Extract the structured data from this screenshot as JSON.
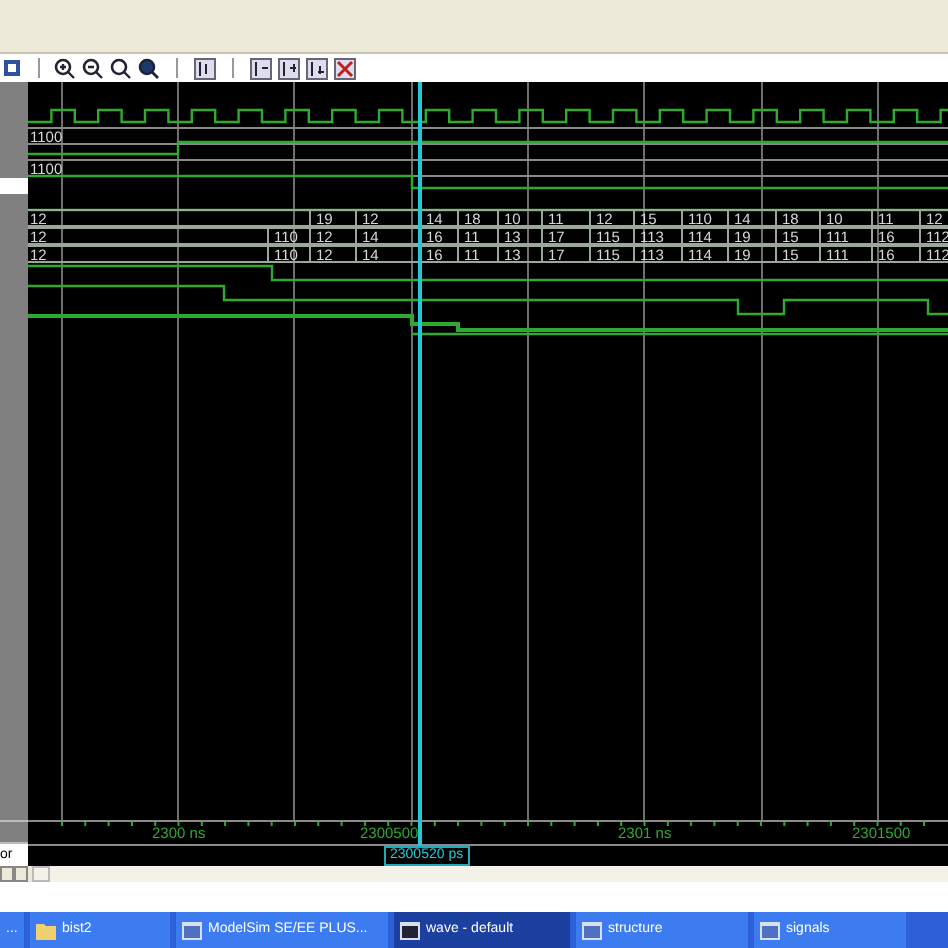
{
  "wave_rows": [
    {
      "kind": "clock"
    },
    {
      "kind": "bus",
      "values": [
        "1100"
      ]
    },
    {
      "kind": "bit"
    },
    {
      "kind": "bus",
      "values": [
        "1100"
      ]
    },
    {
      "kind": "bit"
    },
    {
      "kind": "bit"
    },
    {
      "kind": "bus",
      "values": [
        "12",
        "19",
        "12",
        "14",
        "18",
        "10",
        "11",
        "12",
        "15",
        "110",
        "14",
        "18",
        "10",
        "11",
        "12"
      ]
    },
    {
      "kind": "bus",
      "values": [
        "12",
        "110",
        "12",
        "14",
        "16",
        "11",
        "13",
        "17",
        "115",
        "113",
        "114",
        "19",
        "15",
        "111",
        "16",
        "112"
      ]
    },
    {
      "kind": "bus",
      "values": [
        "12",
        "110",
        "12",
        "14",
        "16",
        "11",
        "13",
        "17",
        "115",
        "113",
        "114",
        "19",
        "15",
        "111",
        "16",
        "112"
      ]
    },
    {
      "kind": "bit"
    },
    {
      "kind": "bit"
    },
    {
      "kind": "bit"
    },
    {
      "kind": "bit"
    }
  ],
  "ruler": {
    "labels": [
      "2300 ns",
      "2300500",
      "2301 ns",
      "2301500"
    ]
  },
  "cursor": {
    "time": "2300520 ps"
  },
  "left_pane": {
    "cursor_label": "or"
  },
  "taskbar": {
    "items": [
      {
        "label": "...",
        "selected": false
      },
      {
        "label": "bist2",
        "selected": false
      },
      {
        "label": "ModelSim SE/EE PLUS...",
        "selected": false
      },
      {
        "label": "wave - default",
        "selected": true
      },
      {
        "label": "structure",
        "selected": false
      },
      {
        "label": "signals",
        "selected": false
      }
    ]
  }
}
